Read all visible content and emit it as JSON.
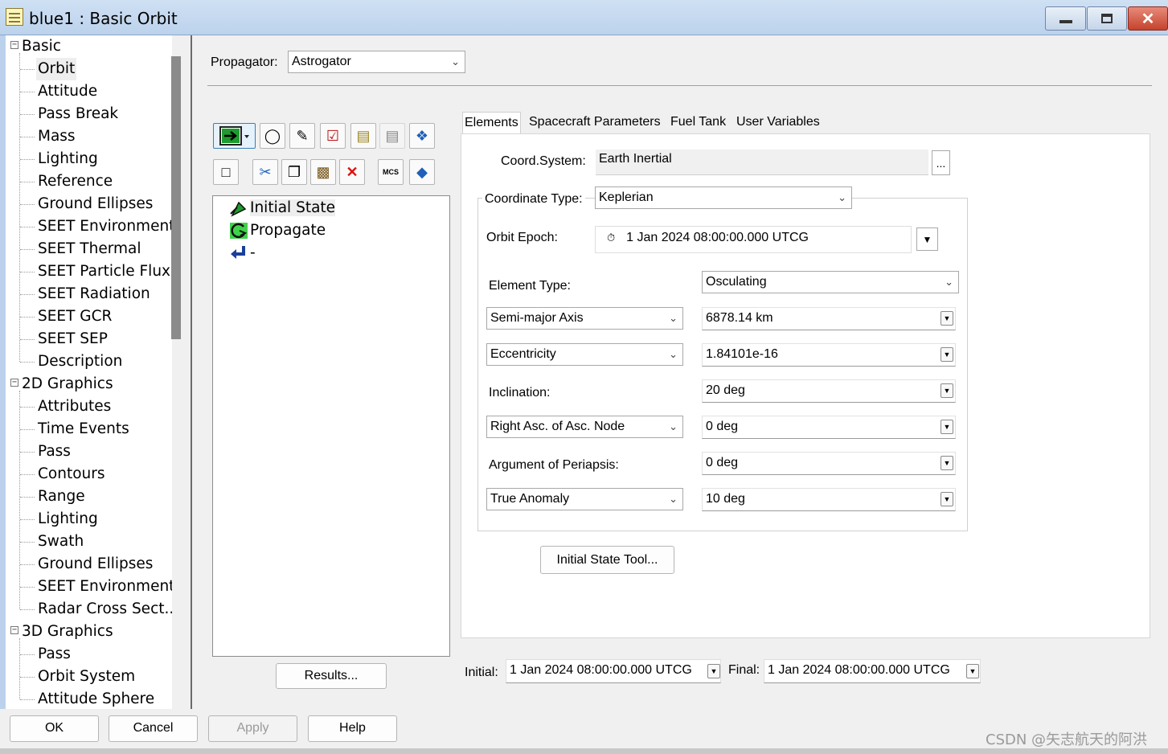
{
  "window": {
    "title": "blue1 : Basic Orbit",
    "controls": {
      "min": "minimize-icon",
      "max": "maximize-icon",
      "close": "✕"
    }
  },
  "tree": {
    "groups": [
      {
        "label": "Basic",
        "toggle": "−",
        "items": [
          "Orbit",
          "Attitude",
          "Pass Break",
          "Mass",
          "Lighting",
          "Reference",
          "Ground Ellipses",
          "SEET Environment",
          "SEET Thermal",
          "SEET Particle Flux",
          "SEET Radiation",
          "SEET GCR",
          "SEET SEP",
          "Description"
        ]
      },
      {
        "label": "2D Graphics",
        "toggle": "−",
        "items": [
          "Attributes",
          "Time Events",
          "Pass",
          "Contours",
          "Range",
          "Lighting",
          "Swath",
          "Ground Ellipses",
          "SEET Environment",
          "Radar Cross Sect..."
        ]
      },
      {
        "label": "3D Graphics",
        "toggle": "−",
        "items": [
          "Pass",
          "Orbit System",
          "Attitude Sphere"
        ]
      }
    ],
    "selected": "Orbit"
  },
  "propagator": {
    "label": "Propagator:",
    "value": "Astrogator"
  },
  "sequence": {
    "items": [
      {
        "label": "Initial State",
        "icon": "initial-state-icon"
      },
      {
        "label": "Propagate",
        "icon": "propagate-icon"
      },
      {
        "label": "-",
        "icon": "return-icon"
      }
    ],
    "results_button": "Results..."
  },
  "tabs": [
    "Elements",
    "Spacecraft Parameters",
    "Fuel Tank",
    "User Variables"
  ],
  "elements": {
    "coord_system_label": "Coord.System:",
    "coord_system_value": "Earth Inertial",
    "coord_system_btn": "...",
    "coord_type_label": "Coordinate Type:",
    "coord_type_value": "Keplerian",
    "orbit_epoch_label": "Orbit Epoch:",
    "orbit_epoch_value": "1 Jan 2024 08:00:00.000 UTCG",
    "element_type_label": "Element Type:",
    "element_type_value": "Osculating",
    "rows": [
      {
        "label": "Semi-major Axis",
        "dropdown": true,
        "value": "6878.14 km"
      },
      {
        "label": "Eccentricity",
        "dropdown": true,
        "value": "1.84101e-16"
      },
      {
        "label": "Inclination:",
        "dropdown": false,
        "value": "20 deg"
      },
      {
        "label": "Right Asc. of Asc. Node",
        "dropdown": true,
        "value": "0 deg"
      },
      {
        "label": "Argument of Periapsis:",
        "dropdown": false,
        "value": "0 deg"
      },
      {
        "label": "True Anomaly",
        "dropdown": true,
        "value": "10 deg"
      }
    ],
    "tool_button": "Initial State Tool..."
  },
  "times": {
    "initial_label": "Initial:",
    "initial_value": "1 Jan 2024 08:00:00.000 UTCG",
    "final_label": "Final:",
    "final_value": "1 Jan 2024 08:00:00.000 UTCG"
  },
  "buttons": {
    "ok": "OK",
    "cancel": "Cancel",
    "apply": "Apply",
    "help": "Help"
  },
  "watermark": "CSDN @矢志航天的阿洪"
}
